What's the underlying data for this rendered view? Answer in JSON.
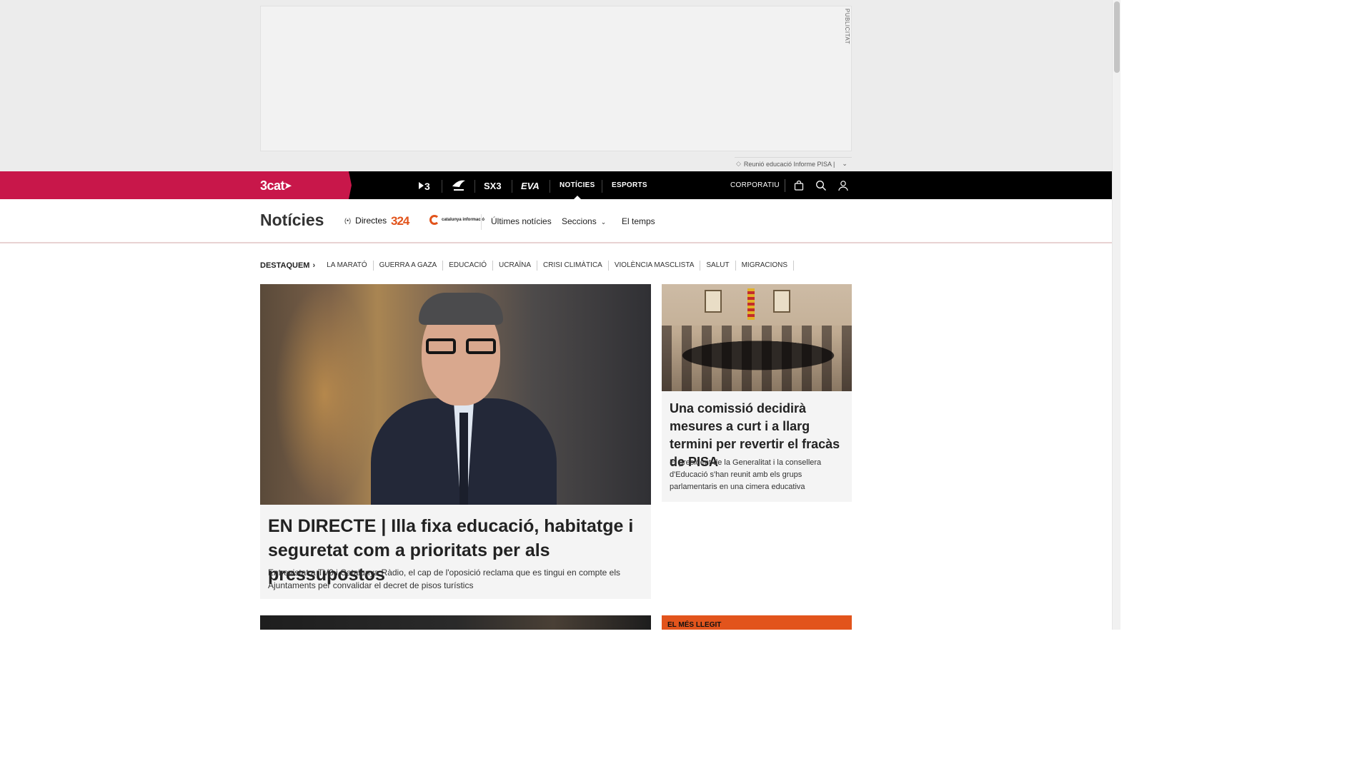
{
  "ad": {
    "label": "PUBLICITAT",
    "info_text": "Reunió educació Informe PISA |"
  },
  "topnav": {
    "brand": "3cat",
    "channels": [
      {
        "name": "3",
        "icon": "tv3-logo-icon"
      },
      {
        "name": "Cat Ràdio",
        "icon": "catradio-logo-icon"
      },
      {
        "name": "SX3",
        "icon": "sx3-logo-icon"
      },
      {
        "name": "EVA",
        "icon": "eva-logo-icon"
      }
    ],
    "links": [
      "NOTÍCIES",
      "ESPORTS"
    ],
    "active": "NOTÍCIES",
    "corporatiu": "CORPORATIU"
  },
  "section": {
    "title": "Notícies",
    "directes": "Directes",
    "logo_324": "324",
    "logo_ci": "catalunya informació",
    "links": [
      "Últimes notícies",
      "Seccions",
      "El temps"
    ]
  },
  "destaquem": {
    "label": "DESTAQUEM",
    "items": [
      "LA MARATÓ",
      "GUERRA A GAZA",
      "EDUCACIÓ",
      "UCRAÏNA",
      "CRISI CLIMÀTICA",
      "VIOLÈNCIA MASCLISTA",
      "SALUT",
      "MIGRACIONS"
    ]
  },
  "main_story": {
    "headline": "EN DIRECTE | Illa fixa educació, habitatge i seguretat com a prioritats per als pressupostos",
    "summary": "Entrevistat a TV3 i Catalunya Ràdio, el cap de l'oposició reclama que es tingui en compte els Ajuntaments per convalidar el decret de pisos turístics"
  },
  "side_story": {
    "headline": "Una comissió decidirà mesures a curt i a llarg termini per revertir el fracàs de PISA",
    "summary": "El president de la Generalitat i la consellera d'Educació s'han reunit amb els grups parlamentaris en una cimera educativa"
  },
  "mes_llegit": {
    "label": "EL MÉS LLEGIT"
  },
  "colors": {
    "brand": "#c8174a",
    "nav_bg": "#000000",
    "accent": "#e2541c"
  }
}
